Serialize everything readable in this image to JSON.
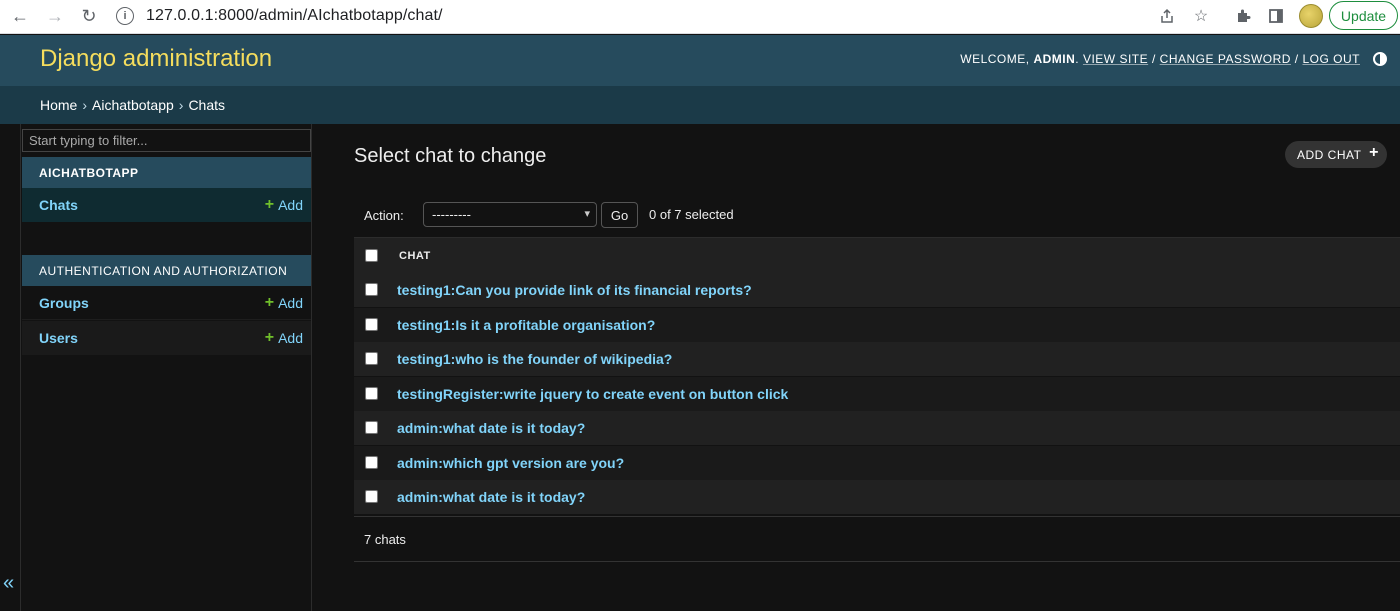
{
  "browser": {
    "back_icon": "←",
    "forward_icon": "→",
    "reload_icon": "↻",
    "url": "127.0.0.1:8000/admin/AIchatbotapp/chat/",
    "update_label": "Update"
  },
  "header": {
    "site_name": "Django administration",
    "welcome": "WELCOME,",
    "username": "ADMIN",
    "view_site": "VIEW SITE",
    "change_password": "CHANGE PASSWORD",
    "log_out": "LOG OUT",
    "separator": "/"
  },
  "breadcrumbs": {
    "home": "Home",
    "app": "Aichatbotapp",
    "current": "Chats",
    "sep": "›"
  },
  "sidebar": {
    "filter_placeholder": "Start typing to filter...",
    "collapse": "«",
    "modules": [
      {
        "caption": "AICHATBOTAPP",
        "models": [
          {
            "label": "Chats",
            "add": "Add"
          }
        ]
      },
      {
        "caption": "AUTHENTICATION AND AUTHORIZATION",
        "models": [
          {
            "label": "Groups",
            "add": "Add"
          },
          {
            "label": "Users",
            "add": "Add"
          }
        ]
      }
    ]
  },
  "main": {
    "title": "Select chat to change",
    "add_button": "ADD CHAT",
    "actions": {
      "label": "Action:",
      "selected_option": "---------",
      "go": "Go",
      "selected_count": "0 of 7 selected"
    },
    "table": {
      "header": "CHAT",
      "rows": [
        "testing1:Can you provide link of its financial reports?",
        "testing1:Is it a profitable organisation?",
        "testing1:who is the founder of wikipedia?",
        "testingRegister:write jquery to create event on button click",
        "admin:what date is it today?",
        "admin:which gpt version are you?",
        "admin:what date is it today?"
      ]
    },
    "paginator": "7 chats"
  },
  "colors": {
    "header_bg": "#264b5d",
    "brand_text": "#f5dd5d",
    "link": "#81d4fa",
    "add_plus": "#70bf2b",
    "body_bg": "#121212"
  }
}
